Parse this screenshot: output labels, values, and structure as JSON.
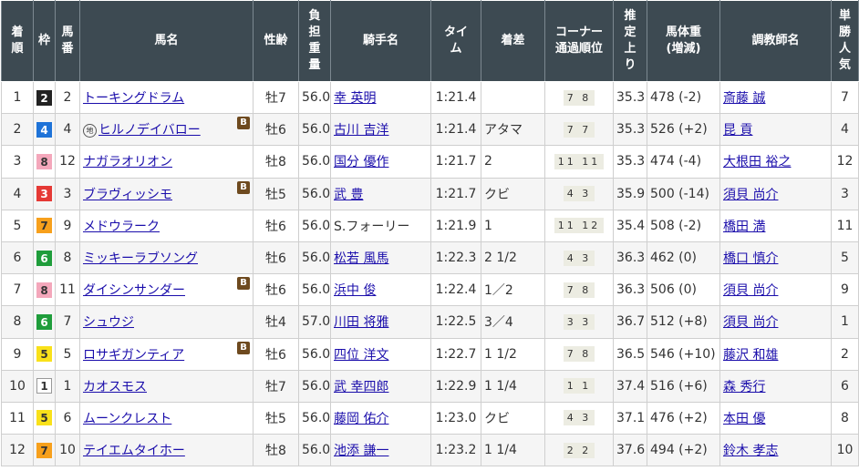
{
  "headers": {
    "rank": "着\n順",
    "waku": "枠",
    "umaban": "馬\n番",
    "horse": "馬名",
    "sexage": "性齢",
    "weight": "負\n担\n重\n量",
    "jockey": "騎手名",
    "time": "タイ\nム",
    "margin": "着差",
    "corner": "コーナー\n通過順位",
    "last3f": "推\n定\n上\nり",
    "bodyweight": "馬体重\n(増減)",
    "trainer": "調教師名",
    "pop": "単\n勝\n人\n気"
  },
  "waku_colors": {
    "1": {
      "bg": "#ffffff",
      "fg": "#333333",
      "border": "#999999"
    },
    "2": {
      "bg": "#222222",
      "fg": "#ffffff",
      "border": "#222222"
    },
    "3": {
      "bg": "#e53935",
      "fg": "#ffffff",
      "border": "#e53935"
    },
    "4": {
      "bg": "#1e73d8",
      "fg": "#ffffff",
      "border": "#1e73d8"
    },
    "5": {
      "bg": "#f9e11a",
      "fg": "#333333",
      "border": "#f9e11a"
    },
    "6": {
      "bg": "#1f9d3b",
      "fg": "#ffffff",
      "border": "#1f9d3b"
    },
    "7": {
      "bg": "#f7a01c",
      "fg": "#333333",
      "border": "#f7a01c"
    },
    "8": {
      "bg": "#f4a7bb",
      "fg": "#333333",
      "border": "#f4a7bb"
    }
  },
  "blinker_label": "B",
  "local_mark": "地",
  "rows": [
    {
      "rank": "1",
      "waku": "2",
      "umaban": "2",
      "horse": "トーキングドラム",
      "local": false,
      "blinker": false,
      "sexage": "牡7",
      "weight": "56.0",
      "jockey": "幸 英明",
      "time": "1:21.4",
      "margin": "",
      "corner": "7 8",
      "last3f": "35.3",
      "bodyweight": "478 (-2)",
      "trainer": "斎藤 誠",
      "pop": "7"
    },
    {
      "rank": "2",
      "waku": "4",
      "umaban": "4",
      "horse": "ヒルノデイバロー",
      "local": true,
      "blinker": true,
      "sexage": "牡6",
      "weight": "56.0",
      "jockey": "古川 吉洋",
      "time": "1:21.4",
      "margin": "アタマ",
      "corner": "7 7",
      "last3f": "35.3",
      "bodyweight": "526 (+2)",
      "trainer": "昆 貢",
      "pop": "4"
    },
    {
      "rank": "3",
      "waku": "8",
      "umaban": "12",
      "horse": "ナガラオリオン",
      "local": false,
      "blinker": false,
      "sexage": "牡8",
      "weight": "56.0",
      "jockey": "国分 優作",
      "time": "1:21.7",
      "margin": "2",
      "corner": "11 11",
      "last3f": "35.3",
      "bodyweight": "474 (-4)",
      "trainer": "大根田 裕之",
      "pop": "12"
    },
    {
      "rank": "4",
      "waku": "3",
      "umaban": "3",
      "horse": "ブラヴィッシモ",
      "local": false,
      "blinker": true,
      "sexage": "牡5",
      "weight": "56.0",
      "jockey": "武 豊",
      "time": "1:21.7",
      "margin": "クビ",
      "corner": "4 3",
      "last3f": "35.9",
      "bodyweight": "500 (-14)",
      "trainer": "須貝 尚介",
      "pop": "3"
    },
    {
      "rank": "5",
      "waku": "7",
      "umaban": "9",
      "horse": "メドウラーク",
      "local": false,
      "blinker": false,
      "sexage": "牡6",
      "weight": "56.0",
      "jockey": "S.フォーリー",
      "time": "1:21.9",
      "margin": "1",
      "corner": "11 12",
      "last3f": "35.4",
      "bodyweight": "508 (-2)",
      "trainer": "橋田 満",
      "pop": "11"
    },
    {
      "rank": "6",
      "waku": "6",
      "umaban": "8",
      "horse": "ミッキーラブソング",
      "local": false,
      "blinker": false,
      "sexage": "牡6",
      "weight": "56.0",
      "jockey": "松若 風馬",
      "time": "1:22.3",
      "margin": "2 1/2",
      "corner": "4 3",
      "last3f": "36.3",
      "bodyweight": "462 (0)",
      "trainer": "橋口 慎介",
      "pop": "5"
    },
    {
      "rank": "7",
      "waku": "8",
      "umaban": "11",
      "horse": "ダイシンサンダー",
      "local": false,
      "blinker": true,
      "sexage": "牡6",
      "weight": "56.0",
      "jockey": "浜中 俊",
      "time": "1:22.4",
      "margin": "1／2",
      "corner": "7 8",
      "last3f": "36.3",
      "bodyweight": "506 (0)",
      "trainer": "須貝 尚介",
      "pop": "9"
    },
    {
      "rank": "8",
      "waku": "6",
      "umaban": "7",
      "horse": "シュウジ",
      "local": false,
      "blinker": false,
      "sexage": "牡4",
      "weight": "57.0",
      "jockey": "川田 将雅",
      "time": "1:22.5",
      "margin": "3／4",
      "corner": "3 3",
      "last3f": "36.7",
      "bodyweight": "512 (+8)",
      "trainer": "須貝 尚介",
      "pop": "1"
    },
    {
      "rank": "9",
      "waku": "5",
      "umaban": "5",
      "horse": "ロサギガンティア",
      "local": false,
      "blinker": true,
      "sexage": "牡6",
      "weight": "56.0",
      "jockey": "四位 洋文",
      "time": "1:22.7",
      "margin": "1 1/2",
      "corner": "7 8",
      "last3f": "36.5",
      "bodyweight": "546 (+10)",
      "trainer": "藤沢 和雄",
      "pop": "2"
    },
    {
      "rank": "10",
      "waku": "1",
      "umaban": "1",
      "horse": "カオスモス",
      "local": false,
      "blinker": false,
      "sexage": "牡7",
      "weight": "56.0",
      "jockey": "武 幸四郎",
      "time": "1:22.9",
      "margin": "1 1/4",
      "corner": "1 1",
      "last3f": "37.4",
      "bodyweight": "516 (+6)",
      "trainer": "森 秀行",
      "pop": "6"
    },
    {
      "rank": "11",
      "waku": "5",
      "umaban": "6",
      "horse": "ムーンクレスト",
      "local": false,
      "blinker": false,
      "sexage": "牡5",
      "weight": "56.0",
      "jockey": "藤岡 佑介",
      "time": "1:23.0",
      "margin": "クビ",
      "corner": "4 3",
      "last3f": "37.1",
      "bodyweight": "476 (+2)",
      "trainer": "本田 優",
      "pop": "8"
    },
    {
      "rank": "12",
      "waku": "7",
      "umaban": "10",
      "horse": "テイエムタイホー",
      "local": false,
      "blinker": false,
      "sexage": "牡8",
      "weight": "56.0",
      "jockey": "池添 謙一",
      "time": "1:23.2",
      "margin": "1 1/4",
      "corner": "2 2",
      "last3f": "37.6",
      "bodyweight": "494 (+2)",
      "trainer": "鈴木 孝志",
      "pop": "10"
    }
  ]
}
